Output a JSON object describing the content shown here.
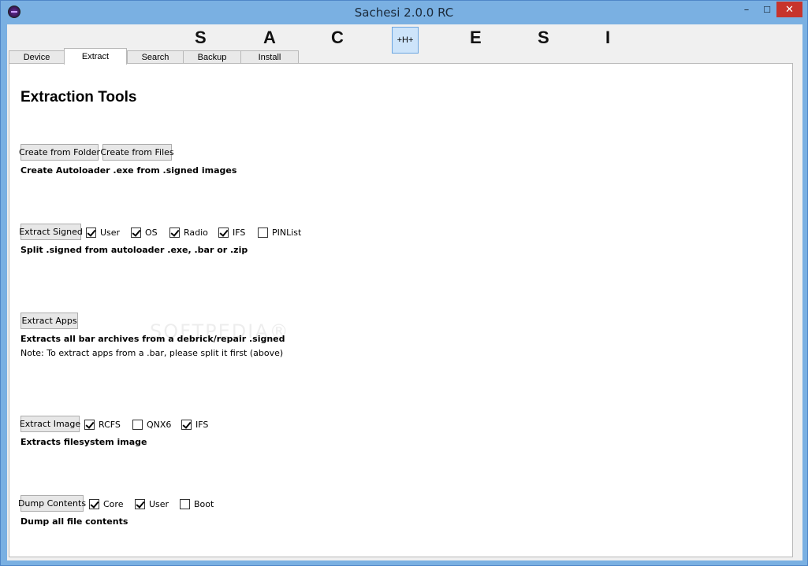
{
  "window": {
    "title": "Sachesi 2.0.0 RC",
    "minimize_glyph": "–",
    "maximize_glyph": "☐",
    "close_glyph": "✕"
  },
  "banner": {
    "letters": [
      "S",
      "A",
      "C",
      "E",
      "S",
      "I"
    ],
    "center_button": "+H+"
  },
  "tabs": [
    "Device",
    "Extract",
    "Search",
    "Backup",
    "Install"
  ],
  "active_tab": "Extract",
  "extract": {
    "heading": "Extraction Tools",
    "create": {
      "folder_button": "Create from Folder",
      "files_button": "Create from Files",
      "description": "Create Autoloader .exe from .signed images"
    },
    "signed": {
      "button": "Extract Signed",
      "options": [
        {
          "label": "User",
          "checked": true
        },
        {
          "label": "OS",
          "checked": true
        },
        {
          "label": "Radio",
          "checked": true
        },
        {
          "label": "IFS",
          "checked": true
        },
        {
          "label": "PINList",
          "checked": false
        }
      ],
      "description": "Split .signed from autoloader .exe, .bar or .zip"
    },
    "apps": {
      "button": "Extract Apps",
      "description": "Extracts all bar archives from a debrick/repair .signed",
      "note": "Note: To extract apps from a .bar, please split it first (above)"
    },
    "image": {
      "button": "Extract Image",
      "options": [
        {
          "label": "RCFS",
          "checked": true
        },
        {
          "label": "QNX6",
          "checked": false
        },
        {
          "label": "IFS",
          "checked": true
        }
      ],
      "description": "Extracts filesystem image"
    },
    "dump": {
      "button": "Dump Contents",
      "options": [
        {
          "label": "Core",
          "checked": true
        },
        {
          "label": "User",
          "checked": true
        },
        {
          "label": "Boot",
          "checked": false
        }
      ],
      "description": "Dump all file contents"
    }
  },
  "watermark": "SOFTPEDIA®",
  "colors": {
    "titlebar": "#7ab0e2",
    "close": "#c7342c",
    "accent_button": "#cde4fa"
  },
  "icons": {
    "app": "sachesi-app-icon",
    "check": "checkmark-icon"
  }
}
